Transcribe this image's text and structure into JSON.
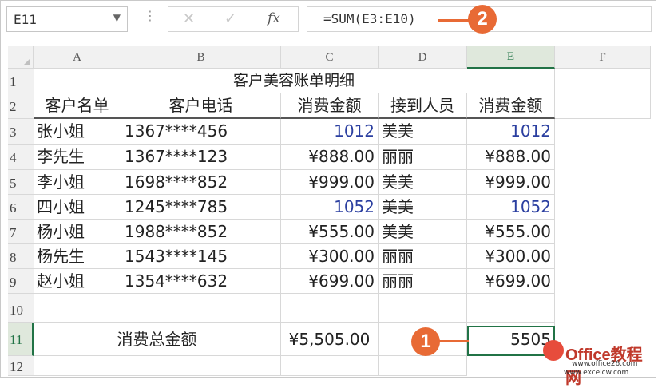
{
  "formula_bar": {
    "name_box": "E11",
    "name_box_arrow": "▼",
    "dots": "⋮",
    "cancel": "✕",
    "enter": "✓",
    "fx": "fx",
    "formula": "=SUM(E3:E10)"
  },
  "columns": [
    "A",
    "B",
    "C",
    "D",
    "E",
    "F"
  ],
  "rows": [
    "1",
    "2",
    "3",
    "4",
    "5",
    "6",
    "7",
    "8",
    "9",
    "10",
    "11",
    "12"
  ],
  "title": "客户美容账单明细",
  "headers": [
    "客户名单",
    "客户电话",
    "消费金额",
    "接到人员",
    "消费金额"
  ],
  "data_rows": [
    {
      "name": "张小姐",
      "phone": "1367****456",
      "amount": "1012",
      "staff": "美美",
      "amount2": "1012"
    },
    {
      "name": "李先生",
      "phone": "1367****123",
      "amount": "¥888.00",
      "staff": "丽丽",
      "amount2": "¥888.00"
    },
    {
      "name": "李小姐",
      "phone": "1698****852",
      "amount": "¥999.00",
      "staff": "美美",
      "amount2": "¥999.00"
    },
    {
      "name": "四小姐",
      "phone": "1245****785",
      "amount": "1052",
      "staff": "美美",
      "amount2": "1052"
    },
    {
      "name": "杨小姐",
      "phone": "1988****852",
      "amount": "¥555.00",
      "staff": "美美",
      "amount2": "¥555.00"
    },
    {
      "name": "杨先生",
      "phone": "1543****145",
      "amount": "¥300.00",
      "staff": "丽丽",
      "amount2": "¥300.00"
    },
    {
      "name": "赵小姐",
      "phone": "1354****632",
      "amount": "¥699.00",
      "staff": "丽丽",
      "amount2": "¥699.00"
    }
  ],
  "total": {
    "label": "消费总金额",
    "amount": "¥5,505.00",
    "value": "5505"
  },
  "callouts": [
    "1",
    "2"
  ],
  "watermark": {
    "logo": "Office教程网",
    "url1": "www.office26.com",
    "url2": "www.excelcw.com"
  },
  "colors": {
    "accent": "#217346",
    "callout": "#e86a35",
    "number_blue": "#2b3fa0"
  }
}
